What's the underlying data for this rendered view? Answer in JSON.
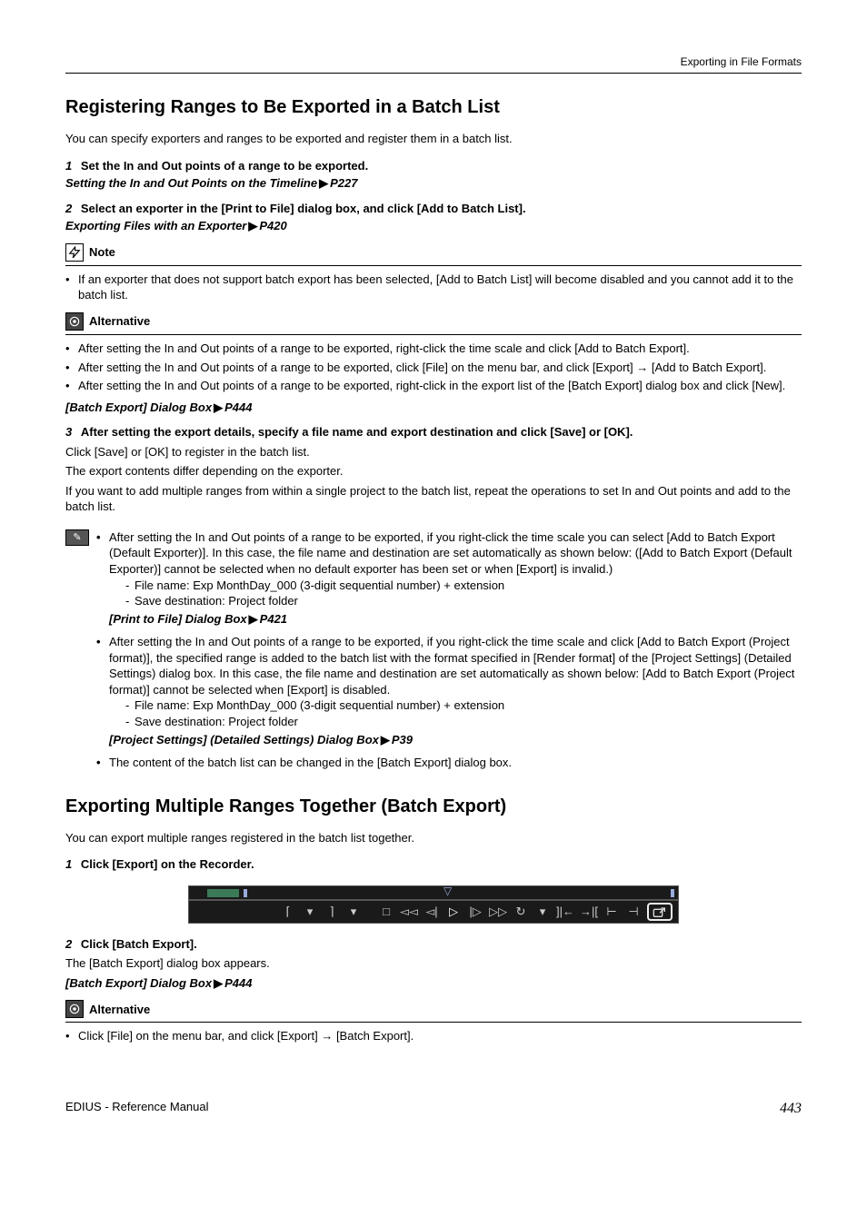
{
  "header": {
    "breadcrumb": "Exporting in File Formats"
  },
  "h1a": "Registering Ranges to Be Exported in a Batch List",
  "intro1": "You can specify exporters and ranges to be exported and register them in a batch list.",
  "step1": {
    "num": "1",
    "txt": "Set the In and Out points of a range to be exported."
  },
  "link1": {
    "label": "Setting the In and Out Points on the Timeline",
    "page": "P227"
  },
  "step2": {
    "num": "2",
    "txt": "Select an exporter in the [Print to File] dialog box, and click [Add to Batch List]."
  },
  "link2": {
    "label": "Exporting Files with an Exporter",
    "page": "P420"
  },
  "note": {
    "label": "Note",
    "items": [
      "If an exporter that does not support batch export has been selected, [Add to Batch List] will become disabled and you cannot add it to the batch list."
    ]
  },
  "alt1": {
    "label": "Alternative",
    "items": [
      "After setting the In and Out points of a range to be exported, right-click the time scale and click [Add to Batch Export].",
      "After setting the In and Out points of a range to be exported, click [File] on the menu bar, and click [Export] → [Add to Batch Export].",
      "After setting the In and Out points of a range to be exported, right-click in the export list of the [Batch Export] dialog box and click [New]."
    ]
  },
  "link3": {
    "label": "[Batch Export] Dialog Box",
    "page": "P444"
  },
  "step3": {
    "num": "3",
    "txt": "After setting the export details, specify a file name and export destination and click [Save] or [OK]."
  },
  "after3": [
    "Click [Save] or [OK] to register in the batch list.",
    "The export contents differ depending on the exporter.",
    "If you want to add multiple ranges from within a single project to the batch list, repeat the operations to set In and Out points and add to the batch list."
  ],
  "tip": {
    "bullets": [
      {
        "text": "After setting the In and Out points of a range to be exported, if you right-click the time scale you can select [Add to Batch Export (Default Exporter)]. In this case, the file name and destination are set automatically as shown below: ([Add to Batch Export (Default Exporter)] cannot be selected when no default exporter has been set or when [Export] is invalid.)",
        "subs": [
          "File name: Exp MonthDay_000 (3-digit sequential number) + extension",
          "Save destination: Project folder"
        ],
        "link": {
          "label": "[Print to File] Dialog Box",
          "page": "P421"
        }
      },
      {
        "text": "After setting the In and Out points of a range to be exported, if you right-click the time scale and click [Add to Batch Export (Project format)], the specified range is added to the batch list with the format specified in [Render format] of the [Project Settings] (Detailed Settings) dialog box. In this case, the file name and destination are set automatically as shown below: [Add to Batch Export (Project format)] cannot be selected when [Export] is disabled.",
        "subs": [
          "File name: Exp MonthDay_000 (3-digit sequential number) + extension",
          "Save destination: Project folder"
        ],
        "link": {
          "label": "[Project Settings] (Detailed Settings) Dialog Box",
          "page": "P39"
        }
      },
      {
        "text": "The content of the batch list can be changed in the [Batch Export] dialog box."
      }
    ]
  },
  "h1b": "Exporting Multiple Ranges Together (Batch Export)",
  "intro2": "You can export multiple ranges registered in the batch list together.",
  "stepB1": {
    "num": "1",
    "txt": "Click [Export] on the Recorder."
  },
  "stepB2": {
    "num": "2",
    "txt": "Click [Batch Export]."
  },
  "afterB2": "The [Batch Export] dialog box appears.",
  "linkB": {
    "label": "[Batch Export] Dialog Box",
    "page": "P444"
  },
  "alt2": {
    "label": "Alternative",
    "items": [
      "Click [File] on the menu bar, and click [Export] → [Batch Export]."
    ]
  },
  "footer": {
    "left": "EDIUS - Reference Manual",
    "page": "443"
  }
}
